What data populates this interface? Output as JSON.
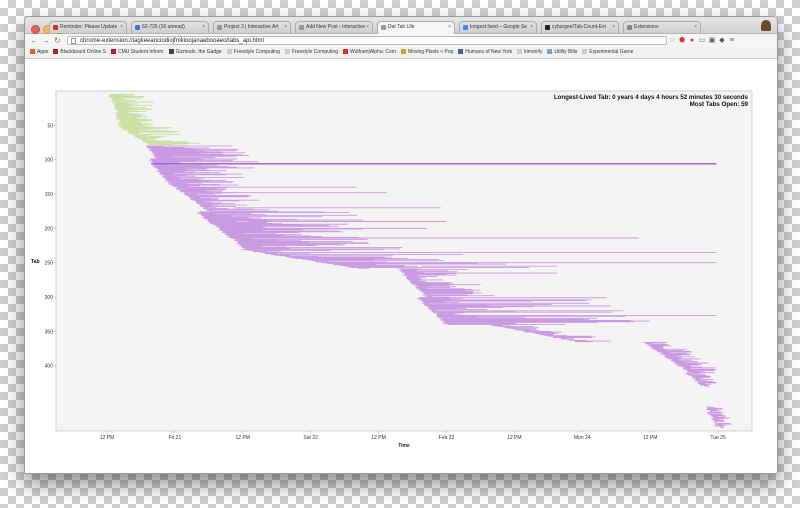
{
  "browser": {
    "tabs": [
      {
        "label": "Reminder: Please Update",
        "icon": "gmail-envelope-icon",
        "color": "#d93025"
      },
      {
        "label": "62-726 (16 unread)",
        "icon": "mail-icon",
        "color": "#3b78e7"
      },
      {
        "label": "Project 3 | Interactive Art",
        "icon": "page-icon",
        "color": "#999999"
      },
      {
        "label": "Add New Post ‹ Interactive",
        "icon": "page-icon",
        "color": "#999999"
      },
      {
        "label": "Dat Tab Life",
        "icon": "page-icon",
        "color": "#999999"
      },
      {
        "label": "longest lived – Google Se",
        "icon": "google-search-icon",
        "color": "#4285f4"
      },
      {
        "label": "cyburgee/Tab-Count-Ext",
        "icon": "github-icon",
        "color": "#222222"
      },
      {
        "label": "Extensions",
        "icon": "puzzle-icon",
        "color": "#888888"
      }
    ],
    "active_tab": 4,
    "url": "chrome-extension://iagkeeanciodiojfmkioojanaebooaeo/tabs_api.html",
    "bookmarks": [
      {
        "label": "Apps",
        "icon": "apps-grid-icon",
        "color": "#e06030"
      },
      {
        "label": "Blackboard Online S",
        "icon": "bookmark-icon",
        "color": "#b02020"
      },
      {
        "label": "CMU Student Inform",
        "icon": "cmu-icon",
        "color": "#c41230"
      },
      {
        "label": "Gizmodo, the Gadge",
        "icon": "g-icon",
        "color": "#444444"
      },
      {
        "label": "Freestyle Computing",
        "icon": "page-icon",
        "color": "#cccccc"
      },
      {
        "label": "Freestyle Computing",
        "icon": "page-icon",
        "color": "#cccccc"
      },
      {
        "label": "Wolfram|Alpha: Com",
        "icon": "wolfram-icon",
        "color": "#dd3322"
      },
      {
        "label": "Moving Pixels < Pop",
        "icon": "pixels-icon",
        "color": "#e0a020"
      },
      {
        "label": "Humans of New York",
        "icon": "hony-icon",
        "color": "#4060a0"
      },
      {
        "label": "kimonify",
        "icon": "page-icon",
        "color": "#cccccc"
      },
      {
        "label": "Utility Bills",
        "icon": "folder-icon",
        "color": "#7aa0d0"
      },
      {
        "label": "Experimental Game",
        "icon": "page-icon",
        "color": "#cccccc"
      }
    ]
  },
  "chart_data": {
    "type": "range-bar",
    "annotations": [
      "Longest-Lived Tab: 0 years 4 days 4 hours 52 minutes 30 seconds",
      "Most Tabs Open: 59"
    ],
    "xlabel": "Time",
    "ylabel": "Tab",
    "x_ticks": [
      "12 PM",
      "Fri 21",
      "12 PM",
      "Sat 22",
      "12 PM",
      "Feb 23",
      "12 PM",
      "Mon 24",
      "12 PM",
      "Tue 25"
    ],
    "x_tick_hours": [
      12,
      24,
      36,
      48,
      60,
      72,
      84,
      96,
      108,
      120
    ],
    "y_ticks": [
      50,
      100,
      150,
      200,
      250,
      300,
      350,
      400
    ],
    "xlim_hours": [
      3,
      126
    ],
    "ylim": [
      0,
      495
    ],
    "colors": {
      "tab": "#c99ae3",
      "early": "#c8e0a0",
      "highlight": "#9b59d0"
    },
    "note_x": "x values are hours since 00:00 on Thu 20 Feb",
    "highlight": {
      "tab": 106,
      "start": 19.8,
      "end": 119.7
    },
    "groups": [
      {
        "y0": 5,
        "y1": 32,
        "start0": 12.5,
        "start1": 14.0,
        "dur0": 1.0,
        "dur1": 7.0,
        "color": "early"
      },
      {
        "y0": 33,
        "y1": 52,
        "start0": 13.5,
        "start1": 14.5,
        "dur0": 3.0,
        "dur1": 6.0,
        "color": "early"
      },
      {
        "y0": 53,
        "y1": 78,
        "start0": 14.5,
        "start1": 19.5,
        "dur0": 1.5,
        "dur1": 10.0,
        "color": "early"
      },
      {
        "y0": 80,
        "y1": 98,
        "start0": 19.3,
        "start1": 20.5,
        "dur0": 2.0,
        "dur1": 17.0,
        "color": "tab"
      },
      {
        "y0": 99,
        "y1": 130,
        "start0": 19.5,
        "start1": 22.5,
        "dur0": 2.0,
        "dur1": 19.0,
        "color": "tab"
      },
      {
        "y0": 131,
        "y1": 175,
        "start0": 22.5,
        "start1": 30.0,
        "dur0": 1.0,
        "dur1": 12.0,
        "color": "tab"
      },
      {
        "y0": 176,
        "y1": 230,
        "start0": 28.0,
        "start1": 36.5,
        "dur0": 1.0,
        "dur1": 29.0,
        "color": "tab"
      },
      {
        "y0": 231,
        "y1": 258,
        "start0": 36.0,
        "start1": 56.0,
        "dur0": 2.0,
        "dur1": 34.0,
        "color": "tab"
      },
      {
        "y0": 259,
        "y1": 300,
        "start0": 63.5,
        "start1": 68.5,
        "dur0": 0.5,
        "dur1": 12.0,
        "color": "tab"
      },
      {
        "y0": 301,
        "y1": 340,
        "start0": 67.0,
        "start1": 72.0,
        "dur0": 0.5,
        "dur1": 36.0,
        "color": "tab"
      },
      {
        "y0": 341,
        "y1": 365,
        "start0": 80.0,
        "start1": 95.0,
        "dur0": 1.0,
        "dur1": 8.0,
        "color": "tab"
      },
      {
        "y0": 366,
        "y1": 410,
        "start0": 107.0,
        "start1": 115.0,
        "dur0": 1.0,
        "dur1": 6.0,
        "color": "tab"
      },
      {
        "y0": 411,
        "y1": 430,
        "start0": 114.5,
        "start1": 117.5,
        "dur0": 0.5,
        "dur1": 3.5,
        "color": "tab"
      },
      {
        "y0": 460,
        "y1": 490,
        "start0": 117.8,
        "start1": 120.0,
        "dur0": 0.2,
        "dur1": 3.0,
        "color": "tab"
      }
    ],
    "long_tabs": [
      {
        "tab": 140,
        "start": 31.5,
        "end": 56.0
      },
      {
        "tab": 148,
        "start": 29.5,
        "end": 61.5
      },
      {
        "tab": 170,
        "start": 34.5,
        "end": 71.0
      },
      {
        "tab": 190,
        "start": 37.0,
        "end": 72.0
      },
      {
        "tab": 200,
        "start": 34.5,
        "end": 68.5
      },
      {
        "tab": 214,
        "start": 38.5,
        "end": 106.0
      },
      {
        "tab": 235,
        "start": 56.0,
        "end": 119.7
      },
      {
        "tab": 250,
        "start": 67.0,
        "end": 119.7
      },
      {
        "tab": 255,
        "start": 67.5,
        "end": 91.5
      },
      {
        "tab": 265,
        "start": 70.0,
        "end": 91.5
      },
      {
        "tab": 327,
        "start": 73.0,
        "end": 119.7
      },
      {
        "tab": 335,
        "start": 73.5,
        "end": 108.0
      }
    ]
  }
}
